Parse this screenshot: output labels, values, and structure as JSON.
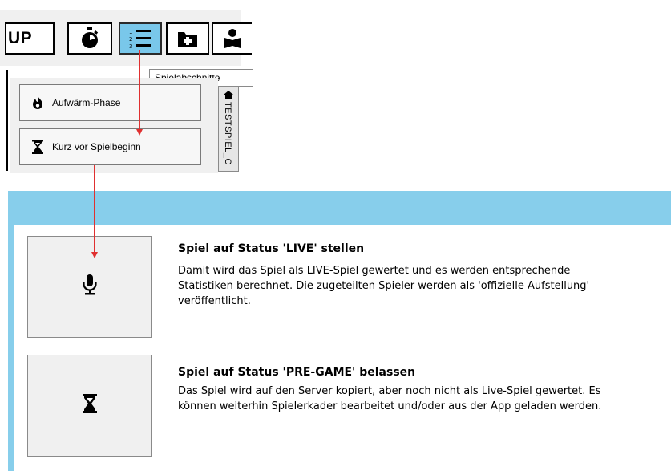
{
  "toolbar": {
    "up_label": "UP",
    "buttons": [
      {
        "icon": "stopwatch-icon"
      },
      {
        "icon": "numbered-list-icon",
        "active": true
      },
      {
        "icon": "folder-plus-icon"
      },
      {
        "icon": "person-book-icon"
      }
    ],
    "tooltip": "Spielabschnitte"
  },
  "phases": {
    "items": [
      {
        "label": "Aufwärm-Phase",
        "icon": "flame-icon"
      },
      {
        "label": "Kurz vor Spielbeginn",
        "icon": "hourglass-icon"
      }
    ],
    "side_tab": "TESTSPIEL_C"
  },
  "dialog": {
    "options": [
      {
        "icon": "microphone-icon",
        "title": "Spiel auf Status 'LIVE' stellen",
        "description": "Damit wird das Spiel als LIVE-Spiel gewertet und es werden entsprechende Statistiken berechnet. Die zugeteilten Spieler werden als 'offizielle Aufstellung' veröffentlicht."
      },
      {
        "icon": "hourglass-icon",
        "title": "Spiel auf Status 'PRE-GAME' belassen",
        "description": "Das Spiel wird auf den Server kopiert, aber noch nicht als Live-Spiel gewertet. Es können weiterhin Spielerkader bearbeitet und/oder aus der App geladen werden."
      }
    ]
  },
  "colors": {
    "accent_blue": "#87ceeb",
    "active_button": "#79c7ea",
    "arrow_red": "#e03030"
  }
}
